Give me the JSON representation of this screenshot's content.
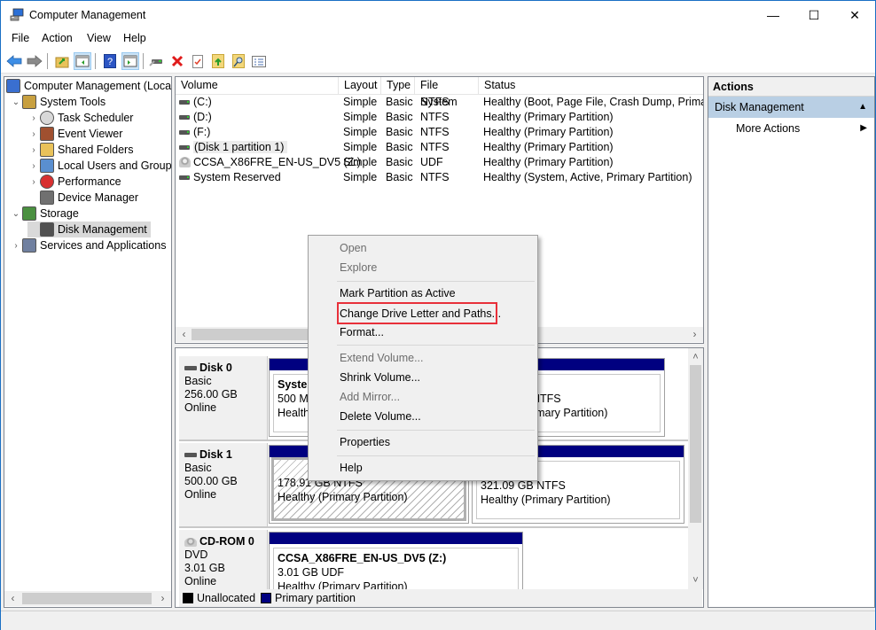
{
  "window": {
    "title": "Computer Management",
    "controls": {
      "minimize": "—",
      "maximize": "☐",
      "close": "✕"
    }
  },
  "menu": [
    "File",
    "Action",
    "View",
    "Help"
  ],
  "toolbar": [
    {
      "icon": "back-arrow-icon",
      "glyph": "⬅"
    },
    {
      "icon": "forward-arrow-icon",
      "glyph": "➡"
    },
    {
      "icon": "up-folder-icon",
      "glyph": "📁"
    },
    {
      "icon": "show-hide-console-tree-icon",
      "glyph": "▤"
    },
    {
      "icon": "help-icon",
      "glyph": "?"
    },
    {
      "icon": "show-hide-action-pane-icon",
      "glyph": "▤"
    },
    {
      "icon": "connect-drive-icon",
      "glyph": "⌁"
    },
    {
      "icon": "delete-icon",
      "glyph": "✖"
    },
    {
      "icon": "properties-icon",
      "glyph": "☑"
    },
    {
      "icon": "export-icon",
      "glyph": "↑"
    },
    {
      "icon": "search-icon",
      "glyph": "⌕"
    },
    {
      "icon": "settings-list-icon",
      "glyph": "☰"
    }
  ],
  "tree": [
    {
      "label": "Computer Management (Local",
      "icon": "computer-management-icon",
      "level": 0,
      "expander": ""
    },
    {
      "label": "System Tools",
      "icon": "system-tools-icon",
      "level": 1,
      "expander": "⌄"
    },
    {
      "label": "Task Scheduler",
      "icon": "clock-icon",
      "level": 2,
      "expander": "›"
    },
    {
      "label": "Event Viewer",
      "icon": "event-viewer-icon",
      "level": 2,
      "expander": "›"
    },
    {
      "label": "Shared Folders",
      "icon": "shared-folders-icon",
      "level": 2,
      "expander": "›"
    },
    {
      "label": "Local Users and Groups",
      "icon": "users-icon",
      "level": 2,
      "expander": "›"
    },
    {
      "label": "Performance",
      "icon": "performance-icon",
      "level": 2,
      "expander": "›"
    },
    {
      "label": "Device Manager",
      "icon": "device-manager-icon",
      "level": 2,
      "expander": ""
    },
    {
      "label": "Storage",
      "icon": "storage-icon",
      "level": 1,
      "expander": "⌄"
    },
    {
      "label": "Disk Management",
      "icon": "disk-management-icon",
      "level": 2,
      "expander": "",
      "selected": true
    },
    {
      "label": "Services and Applications",
      "icon": "services-icon",
      "level": 1,
      "expander": "›"
    }
  ],
  "volumes": {
    "columns": [
      "Volume",
      "Layout",
      "Type",
      "File System",
      "Status"
    ],
    "rows": [
      {
        "volume": "(C:)",
        "layout": "Simple",
        "type": "Basic",
        "fs": "NTFS",
        "status": "Healthy (Boot, Page File, Crash Dump, Primary"
      },
      {
        "volume": "(D:)",
        "layout": "Simple",
        "type": "Basic",
        "fs": "NTFS",
        "status": "Healthy (Primary Partition)"
      },
      {
        "volume": "(F:)",
        "layout": "Simple",
        "type": "Basic",
        "fs": "NTFS",
        "status": "Healthy (Primary Partition)"
      },
      {
        "volume": "(Disk 1 partition 1)",
        "layout": "Simple",
        "type": "Basic",
        "fs": "NTFS",
        "status": "Healthy (Primary Partition)",
        "selected": true
      },
      {
        "volume": "CCSA_X86FRE_EN-US_DV5 (Z:)",
        "layout": "Simple",
        "type": "Basic",
        "fs": "UDF",
        "status": "Healthy (Primary Partition)",
        "cd": true
      },
      {
        "volume": "System Reserved",
        "layout": "Simple",
        "type": "Basic",
        "fs": "NTFS",
        "status": "Healthy (System, Active, Primary Partition)"
      }
    ]
  },
  "disks": [
    {
      "name": "Disk 0",
      "kind": "Basic",
      "size": "256.00 GB",
      "state": "Online",
      "partitions": [
        {
          "title": "System",
          "line1": "500 MB",
          "line2": "Healthy"
        },
        {
          "title": "",
          "line1": "0 GB NTFS",
          "line2": "hy (Primary Partition)"
        }
      ]
    },
    {
      "name": "Disk 1",
      "kind": "Basic",
      "size": "500.00 GB",
      "state": "Online",
      "partitions": [
        {
          "title": "",
          "line1": "178.91 GB NTFS",
          "line2": "Healthy (Primary Partition)",
          "hatched": true
        },
        {
          "title": "",
          "line1": "321.09 GB NTFS",
          "line2": "Healthy (Primary Partition)"
        }
      ]
    },
    {
      "name": "CD-ROM 0",
      "kind": "DVD",
      "size": "3.01 GB",
      "state": "Online",
      "partitions": [
        {
          "title": "CCSA_X86FRE_EN-US_DV5  (Z:)",
          "line1": "3.01 GB UDF",
          "line2": "Healthy (Primary Partition)"
        }
      ]
    }
  ],
  "legend": [
    {
      "label": "Unallocated",
      "color": "#000000"
    },
    {
      "label": "Primary partition",
      "color": "#000080"
    }
  ],
  "actions": {
    "header": "Actions",
    "section": "Disk Management",
    "section_glyph": "▲",
    "items": [
      {
        "label": "More Actions",
        "glyph": "▶"
      }
    ]
  },
  "context_menu": {
    "items": [
      {
        "label": "Open",
        "disabled": true
      },
      {
        "label": "Explore",
        "disabled": true
      },
      {
        "label": "Mark Partition as Active",
        "disabled": false
      },
      {
        "label": "Change Drive Letter and Paths...",
        "disabled": false,
        "highlighted": true
      },
      {
        "label": "Format...",
        "disabled": false
      },
      {
        "label": "Extend Volume...",
        "disabled": true
      },
      {
        "label": "Shrink Volume...",
        "disabled": false
      },
      {
        "label": "Add Mirror...",
        "disabled": true
      },
      {
        "label": "Delete Volume...",
        "disabled": false
      },
      {
        "label": "Properties",
        "disabled": false
      },
      {
        "label": "Help",
        "disabled": false
      }
    ]
  },
  "colors": {
    "primary_partition": "#000080",
    "highlight_box": "#e8303a",
    "actions_section_bg": "#b9cfe4"
  },
  "scroll": {
    "left_tree": "‹",
    "right_tree": "›",
    "up": "˄",
    "down": "˅"
  }
}
